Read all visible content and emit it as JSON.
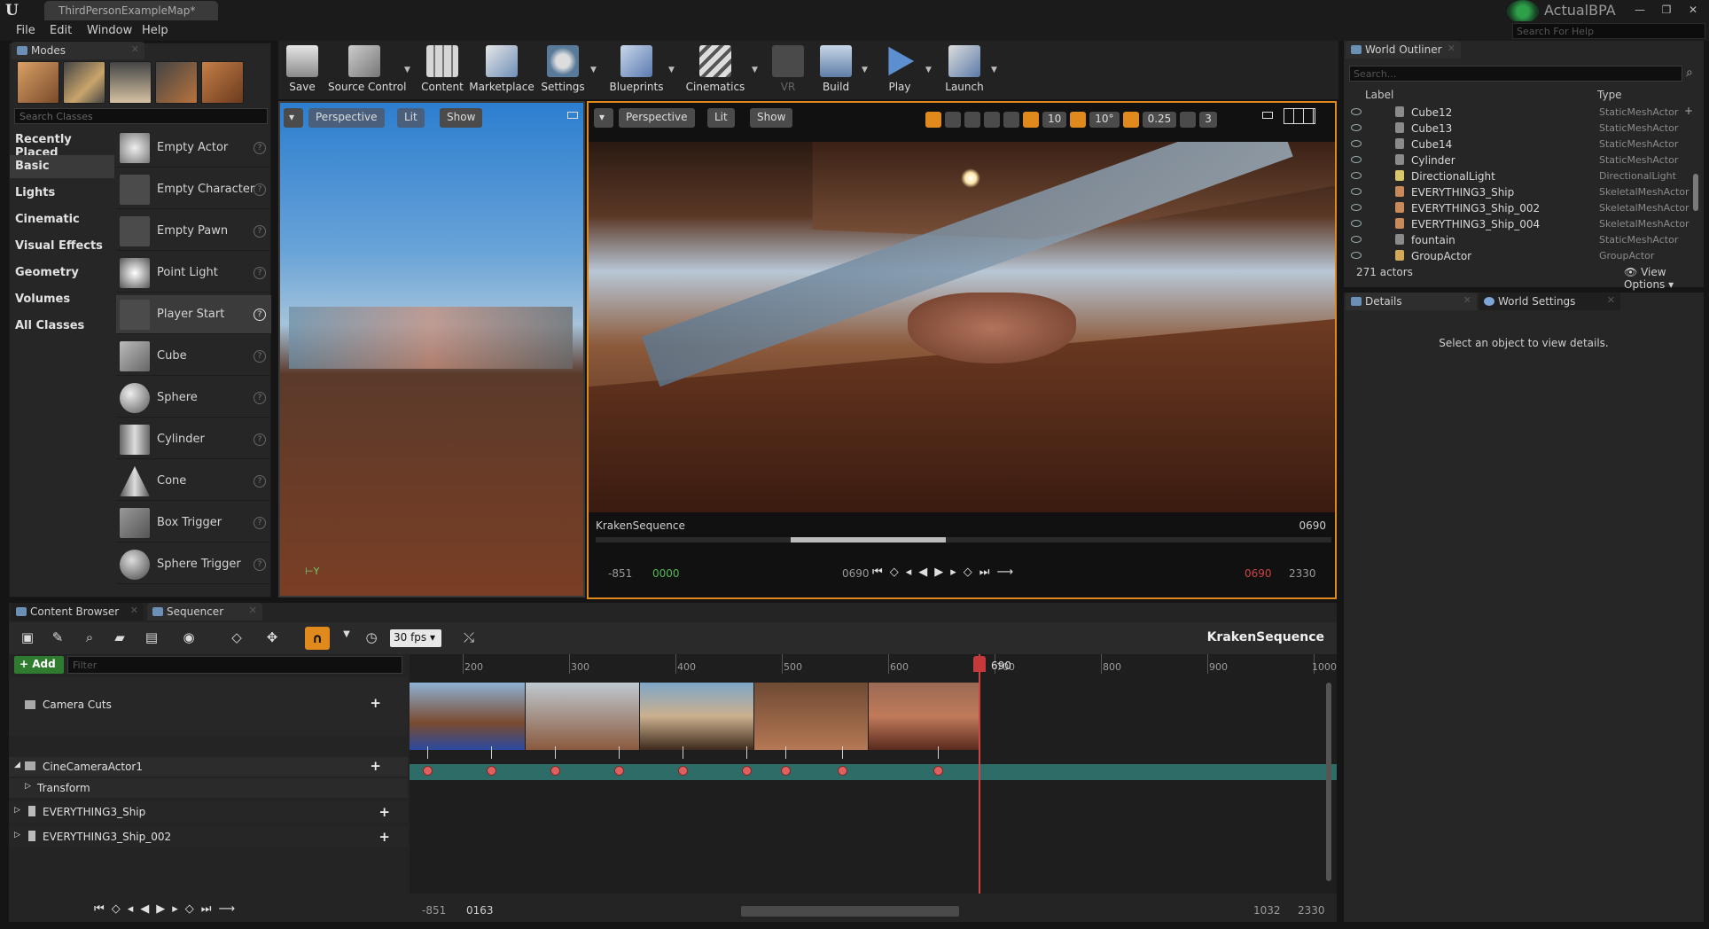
{
  "window": {
    "tab_title": "ThirdPersonExampleMap*",
    "project": "ActualBPA",
    "help_placeholder": "Search For Help",
    "min": "—",
    "max": "❐",
    "close": "✕"
  },
  "menu": [
    "File",
    "Edit",
    "Window",
    "Help"
  ],
  "modes": {
    "tab": "Modes",
    "search_placeholder": "Search Classes",
    "categories": [
      "Recently Placed",
      "Basic",
      "Lights",
      "Cinematic",
      "Visual Effects",
      "Geometry",
      "Volumes",
      "All Classes"
    ],
    "items": [
      "Empty Actor",
      "Empty Character",
      "Empty Pawn",
      "Point Light",
      "Player Start",
      "Cube",
      "Sphere",
      "Cylinder",
      "Cone",
      "Box Trigger",
      "Sphere Trigger"
    ]
  },
  "toolbar": [
    "Save",
    "Source Control",
    "Content",
    "Marketplace",
    "Settings",
    "Blueprints",
    "Cinematics",
    "VR",
    "Build",
    "Play",
    "Launch"
  ],
  "viewport_left": {
    "perspective": "Perspective",
    "lit": "Lit",
    "show": "Show"
  },
  "viewport_right": {
    "perspective": "Perspective",
    "lit": "Lit",
    "show": "Show",
    "grid": "10",
    "rot": "10°",
    "scale": "0.25",
    "cam": "3",
    "sequence": "KrakenSequence",
    "frame": "0690",
    "tc_start": "-851",
    "tc_in": "0000",
    "tc_cur": "0690",
    "tc_out": "0690",
    "tc_end": "2330"
  },
  "outliner": {
    "tab": "World Outliner",
    "search_placeholder": "Search...",
    "col_label": "Label",
    "col_type": "Type",
    "rows": [
      {
        "label": "Cube12",
        "type": "StaticMeshActor"
      },
      {
        "label": "Cube13",
        "type": "StaticMeshActor"
      },
      {
        "label": "Cube14",
        "type": "StaticMeshActor"
      },
      {
        "label": "Cylinder",
        "type": "StaticMeshActor"
      },
      {
        "label": "DirectionalLight",
        "type": "DirectionalLight"
      },
      {
        "label": "EVERYTHING3_Ship",
        "type": "SkeletalMeshActor"
      },
      {
        "label": "EVERYTHING3_Ship_002",
        "type": "SkeletalMeshActor"
      },
      {
        "label": "EVERYTHING3_Ship_004",
        "type": "SkeletalMeshActor"
      },
      {
        "label": "fountain",
        "type": "StaticMeshActor"
      },
      {
        "label": "GroupActor",
        "type": "GroupActor"
      }
    ],
    "count": "271 actors",
    "view_options": "View Options"
  },
  "details": {
    "tab": "Details",
    "tab2": "World Settings",
    "empty": "Select an object to view details."
  },
  "sequencer": {
    "tab_content": "Content Browser",
    "tab": "Sequencer",
    "fps": "30 fps",
    "name": "KrakenSequence",
    "add": "+ Add",
    "filter_placeholder": "Filter",
    "tracks": [
      "Camera Cuts",
      "CineCameraActor1",
      "Transform",
      "EVERYTHING3_Ship",
      "EVERYTHING3_Ship_002"
    ],
    "ruler": [
      "200",
      "300",
      "400",
      "500",
      "600",
      "700",
      "800",
      "900",
      "1000"
    ],
    "playhead": "690",
    "bottom_start": "-851",
    "bottom_in": "0163",
    "bottom_out": "1032",
    "bottom_end": "2330"
  },
  "icons": [
    "ue-logo-icon",
    "save-icon",
    "play-icon",
    "eye-icon",
    "gear-icon",
    "magnet-icon",
    "search-icon"
  ]
}
